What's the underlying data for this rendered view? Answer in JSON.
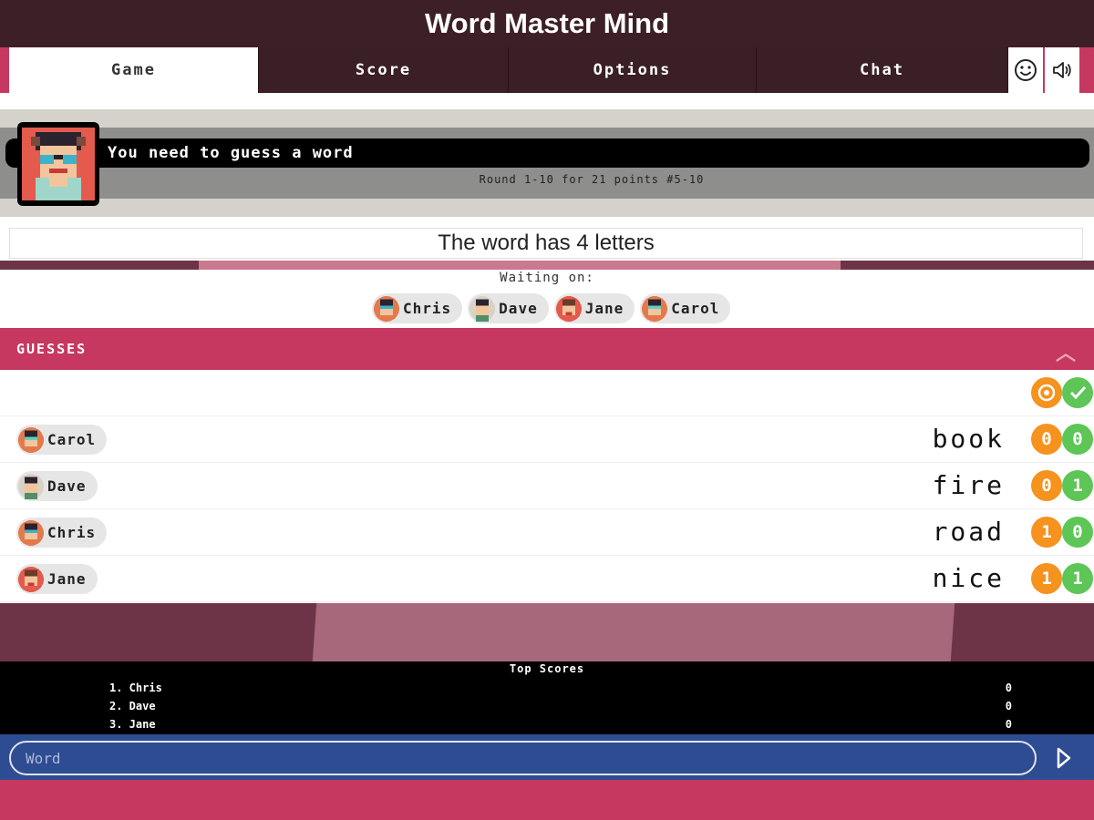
{
  "app": {
    "title": "Word Master Mind"
  },
  "tabs": [
    {
      "label": "Game"
    },
    {
      "label": "Score"
    },
    {
      "label": "Options"
    },
    {
      "label": "Chat"
    }
  ],
  "icons": {
    "smiley": "smiley-icon",
    "sound": "speaker-icon",
    "send": "send-icon",
    "collapse": "chevron-up-icon"
  },
  "header": {
    "message": "You need to guess a word",
    "round_info": "Round 1-10 for 21 points #5-10"
  },
  "word_info": "The word has 4 letters",
  "waiting": {
    "label": "Waiting on:",
    "players": [
      "Chris",
      "Dave",
      "Jane",
      "Carol"
    ]
  },
  "guesses": {
    "title": "GUESSES",
    "rows": [
      {
        "player": "Carol",
        "word": "book",
        "orange": "0",
        "green": "0"
      },
      {
        "player": "Dave",
        "word": "fire",
        "orange": "0",
        "green": "1"
      },
      {
        "player": "Chris",
        "word": "road",
        "orange": "1",
        "green": "0"
      },
      {
        "player": "Jane",
        "word": "nice",
        "orange": "1",
        "green": "1"
      }
    ]
  },
  "top_scores": {
    "title": "Top Scores",
    "rows": [
      {
        "name": "1. Chris",
        "score": "0"
      },
      {
        "name": "2. Dave",
        "score": "0"
      },
      {
        "name": "3. Jane",
        "score": "0"
      }
    ]
  },
  "input": {
    "placeholder": "Word"
  },
  "colors": {
    "primary": "#c6385f",
    "dark": "#3d1f27",
    "input_bg": "#2e4c92",
    "orange": "#f6921e",
    "green": "#5ec557"
  }
}
